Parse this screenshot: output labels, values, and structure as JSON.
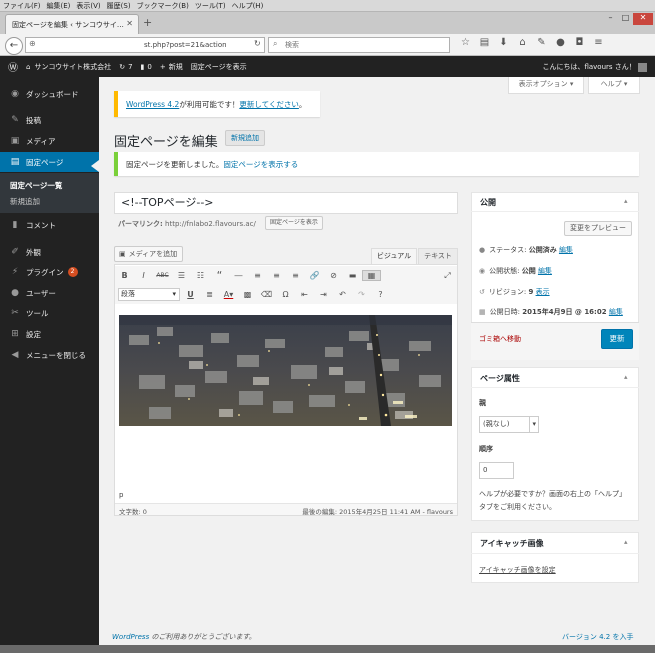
{
  "browser": {
    "menu": [
      "ファイル(F)",
      "編集(E)",
      "表示(V)",
      "履歴(S)",
      "ブックマーク(B)",
      "ツール(T)",
      "ヘルプ(H)"
    ],
    "tab_title": "固定ページを編集 ‹ サンコウサイ…",
    "url": "st.php?post=21&action",
    "search_placeholder": "検索"
  },
  "adminbar": {
    "site_name": "サンコウサイト株式会社",
    "updates_count": "7",
    "comments_count": "0",
    "new_label": "新規",
    "view_page": "固定ページを表示",
    "greeting": "こんにちは、flavours さん！"
  },
  "sidebar": {
    "dashboard": "ダッシュボード",
    "posts": "投稿",
    "media": "メディア",
    "pages": "固定ページ",
    "pages_all": "固定ページ一覧",
    "pages_new": "新規追加",
    "comments": "コメント",
    "appearance": "外観",
    "plugins": "プラグイン",
    "plugins_badge": "2",
    "users": "ユーザー",
    "tools": "ツール",
    "settings": "設定",
    "collapse": "メニューを閉じる"
  },
  "screen_options": "表示オプション ▾",
  "help_tab": "ヘルプ ▾",
  "notice_update": {
    "link": "WordPress 4.2",
    "text": " が利用可能です！",
    "action": "更新してください",
    "end": "。"
  },
  "page_heading": "固定ページを編集",
  "add_new": "新規追加",
  "notice_saved": {
    "text": "固定ページを更新しました。",
    "link": "固定ページを表示する"
  },
  "post_title": "<!--TOPページ-->",
  "permalink": {
    "label": "パーマリンク:",
    "url": "http://fnlabo2.flavours.ac/",
    "button": "固定ページを表示"
  },
  "media_button": "メディアを追加",
  "editor_tabs": {
    "visual": "ビジュアル",
    "text": "テキスト"
  },
  "format_select": "段落",
  "path": "p",
  "status": {
    "word_count": "文字数: 0",
    "last_edit": "最後の編集: 2015年4月25日 11:41 AM - flavours"
  },
  "publish": {
    "title": "公開",
    "preview": "変更をプレビュー",
    "status_label": "ステータス: ",
    "status_value": "公開済み",
    "visibility_label": "公開状態: ",
    "visibility_value": "公開",
    "revisions_label": "リビジョン: ",
    "revisions_value": "9",
    "revisions_link": "表示",
    "date_label": "公開日時: ",
    "date_value": "2015年4月9日 @ 16:02",
    "edit": "編集",
    "trash": "ゴミ箱へ移動",
    "update": "更新"
  },
  "page_attributes": {
    "title": "ページ属性",
    "parent_label": "親",
    "parent_value": "(親なし)",
    "order_label": "順序",
    "order_value": "0",
    "help_line1": "ヘルプが必要ですか？画面の右上の「ヘルプ」",
    "help_line2": "タブをご利用ください。"
  },
  "featured_image": {
    "title": "アイキャッチ画像",
    "link": "アイキャッチ画像を設定"
  },
  "footer": {
    "thanks_link": "WordPress",
    "thanks_text": " のご利用ありがとうございます。",
    "version": "バージョン 4.2 を入手"
  },
  "colors": {
    "admin_blue": "#0073aa",
    "sidebar": "#222222",
    "update_notice": "#ffb900",
    "success_notice": "#7ad03a",
    "trash": "#a00000"
  }
}
